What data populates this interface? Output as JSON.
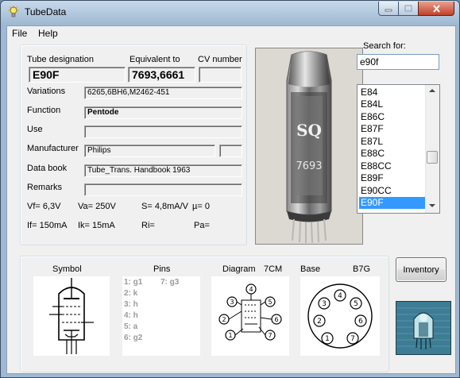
{
  "window": {
    "title": "TubeData"
  },
  "menu": {
    "file": "File",
    "help": "Help"
  },
  "info": {
    "designation_label": "Tube designation",
    "designation_value": "E90F",
    "equivalent_label": "Equivalent to",
    "equivalent_value": "7693,6661",
    "cv_label": "CV number",
    "cv_value": "",
    "variations_label": "Variations",
    "variations_value": "6265,6BH6,M2462-451",
    "function_label": "Function",
    "function_value": "Pentode",
    "use_label": "Use",
    "use_value": "",
    "manufacturer_label": "Manufacturer",
    "manufacturer_value": "Philips",
    "manufacturer_extra": "",
    "databook_label": "Data book",
    "databook_value": "Tube_Trans. Handbook 1963",
    "remarks_label": "Remarks",
    "remarks_value": "",
    "vf": "Vf= 6,3V",
    "va": "Va=  250V",
    "s": "S= 4,8mA/V",
    "mu": "µ=    0",
    "if": "If= 150mA",
    "ik": "Ik=  15mA",
    "ri": "Ri=",
    "pa": "Pa="
  },
  "search": {
    "label": "Search for:",
    "value": "e90f"
  },
  "list": {
    "items": [
      "E84",
      "E84L",
      "E86C",
      "E87F",
      "E87L",
      "E88C",
      "E88CC",
      "E89F",
      "E90CC",
      "E90F"
    ],
    "selected": "E90F"
  },
  "bottom": {
    "symbol_label": "Symbol",
    "pins_label": "Pins",
    "diagram_label": "Diagram",
    "diagram_code": "7CM",
    "base_label": "Base",
    "base_code": "B7G",
    "pins_left": [
      "1: g1",
      "2: k",
      "3: h",
      "4: h",
      "5: a",
      "6: g2"
    ],
    "pins_right": [
      "7: g3"
    ],
    "diagram_pins": [
      "1",
      "2",
      "3",
      "4",
      "5",
      "6",
      "7"
    ],
    "base_pins": [
      "1",
      "2",
      "3",
      "4",
      "5",
      "6",
      "7"
    ]
  },
  "buttons": {
    "inventory": "Inventory"
  },
  "photo": {
    "tube_print_1": "SQ",
    "tube_print_2": "7693"
  },
  "colors": {
    "selection": "#3399ff",
    "titlebar": "#9fb9d2"
  }
}
